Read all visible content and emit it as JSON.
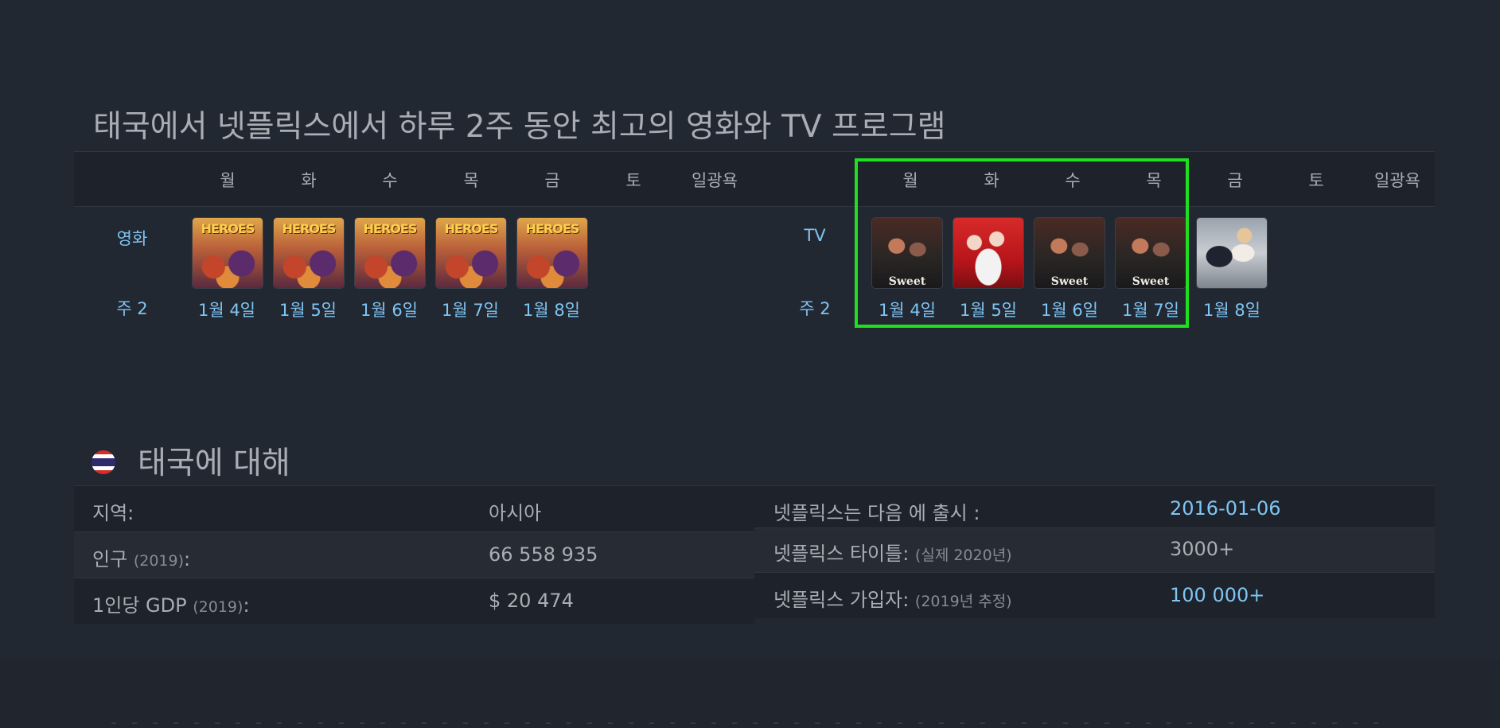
{
  "top10": {
    "title": "태국에서 넷플릭스에서 하루 2주 동안 최고의 영화와 TV 프로그램",
    "days_movies": [
      "월",
      "화",
      "수",
      "목",
      "금",
      "토",
      "일광욕"
    ],
    "days_tv": [
      "월",
      "화",
      "수",
      "목",
      "금",
      "토",
      "일광욕"
    ],
    "movies_label": "영화",
    "tv_label": "TV",
    "week_label_movies": "주 2",
    "week_label_tv": "주 2",
    "movie_posters": [
      {
        "title_art": "HEROES",
        "date": "1월 4일"
      },
      {
        "title_art": "HEROES",
        "date": "1월 5일"
      },
      {
        "title_art": "HEROES",
        "date": "1월 6일"
      },
      {
        "title_art": "HEROES",
        "date": "1월 7일"
      },
      {
        "title_art": "HEROES",
        "date": "1월 8일"
      }
    ],
    "tv_posters": [
      {
        "title_art": "Sweet",
        "date": "1월 4일"
      },
      {
        "title_art": "",
        "date": "1월 5일"
      },
      {
        "title_art": "Sweet",
        "date": "1월 6일"
      },
      {
        "title_art": "Sweet",
        "date": "1월 7일"
      },
      {
        "title_art": "",
        "date": "1월 8일"
      }
    ],
    "highlight_color": "#1fe01f"
  },
  "about": {
    "title": "태국에 대해",
    "flag_icon": "thailand-flag-icon",
    "left": [
      {
        "label": "지역:",
        "sub": "",
        "value": "아시아"
      },
      {
        "label": "인구",
        "sub": "(2019)",
        "suffix": ":",
        "value": "66 558 935"
      },
      {
        "label": "1인당 GDP",
        "sub": "(2019)",
        "suffix": ":",
        "value": "$ 20 474"
      }
    ],
    "right": [
      {
        "label": "넷플릭스는 다음 에 출시 :",
        "sub": "",
        "value": "2016-01-06"
      },
      {
        "label": "넷플릭스 타이틀:",
        "sub": "(실제 2020년)",
        "value": "3000+"
      },
      {
        "label": "넷플릭스 가입자:",
        "sub": "(2019년 추정)",
        "value": "100 000+"
      }
    ]
  },
  "colors": {
    "background": "#222832",
    "accent_link": "#7fc4f2",
    "text": "#a9adb4"
  }
}
